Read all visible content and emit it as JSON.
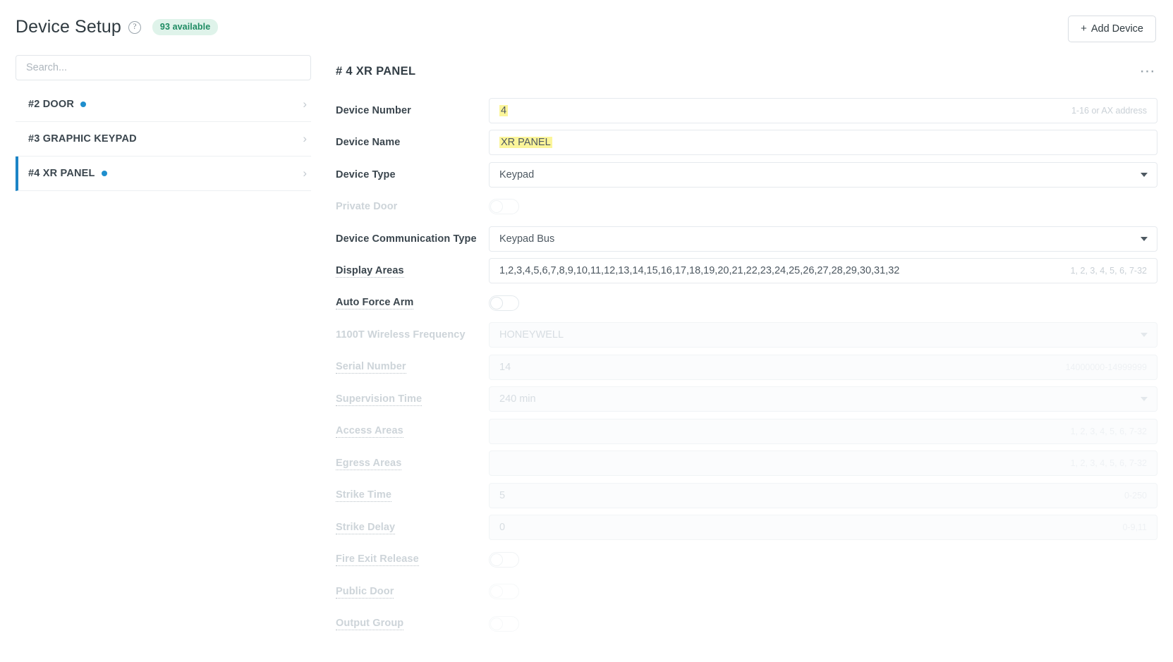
{
  "header": {
    "title": "Device Setup",
    "help_icon": "question-mark",
    "badge": "93 available",
    "badge_color": "#1d8b62",
    "add_button": "Add Device",
    "add_button_plus": "+"
  },
  "sidebar": {
    "search_placeholder": "Search...",
    "items": [
      {
        "label": "#2 DOOR",
        "has_dot": true,
        "selected": false
      },
      {
        "label": "#3 GRAPHIC KEYPAD",
        "has_dot": false,
        "selected": false
      },
      {
        "label": "#4 XR PANEL",
        "has_dot": true,
        "selected": true
      }
    ]
  },
  "detail": {
    "title": "# 4 XR PANEL",
    "menu_icon": "•••",
    "fields": [
      {
        "label": "Device Number",
        "type": "text",
        "value": "4",
        "highlight": true,
        "hint": "1-16 or AX address",
        "disabled": false,
        "dotted": false
      },
      {
        "label": "Device Name",
        "type": "text",
        "value": "XR PANEL",
        "highlight": true,
        "hint": "",
        "disabled": false,
        "dotted": false
      },
      {
        "label": "Device Type",
        "type": "select",
        "value": "Keypad",
        "hint": "",
        "disabled": false,
        "dotted": false
      },
      {
        "label": "Private Door",
        "type": "toggle",
        "value": "off",
        "disabled": true,
        "dotted": false
      },
      {
        "label": "Device Communication Type",
        "type": "select",
        "value": "Keypad Bus",
        "hint": "",
        "disabled": false,
        "dotted": false
      },
      {
        "label": "Display Areas",
        "type": "text",
        "value": "1,2,3,4,5,6,7,8,9,10,11,12,13,14,15,16,17,18,19,20,21,22,23,24,25,26,27,28,29,30,31,32",
        "hint": "1, 2, 3, 4, 5, 6, 7-32",
        "disabled": false,
        "dotted": true
      },
      {
        "label": "Auto Force Arm",
        "type": "toggle",
        "value": "off",
        "disabled": false,
        "dotted": true
      },
      {
        "label": "1100T Wireless Frequency",
        "type": "select",
        "value": "HONEYWELL",
        "hint": "",
        "disabled": true,
        "dotted": false
      },
      {
        "label": "Serial Number",
        "type": "text",
        "value": "14",
        "hint": "14000000-14999999",
        "disabled": true,
        "dotted": true
      },
      {
        "label": "Supervision Time",
        "type": "select",
        "value": "240 min",
        "hint": "",
        "disabled": true,
        "dotted": true
      },
      {
        "label": "Access Areas",
        "type": "text",
        "value": "",
        "hint": "1, 2, 3, 4, 5, 6, 7-32",
        "disabled": true,
        "dotted": true
      },
      {
        "label": "Egress Areas",
        "type": "text",
        "value": "",
        "hint": "1, 2, 3, 4, 5, 6, 7-32",
        "disabled": true,
        "dotted": true
      },
      {
        "label": "Strike Time",
        "type": "text",
        "value": "5",
        "hint": "0-250",
        "disabled": true,
        "dotted": true
      },
      {
        "label": "Strike Delay",
        "type": "text",
        "value": "0",
        "hint": "0-9,11",
        "disabled": true,
        "dotted": true
      },
      {
        "label": "Fire Exit Release",
        "type": "toggle",
        "value": "off",
        "disabled": true,
        "dotted": true
      },
      {
        "label": "Public Door",
        "type": "toggle",
        "value": "off",
        "disabled": true,
        "dotted": true
      },
      {
        "label": "Output Group",
        "type": "toggle",
        "value": "off",
        "disabled": true,
        "dotted": true
      }
    ]
  }
}
